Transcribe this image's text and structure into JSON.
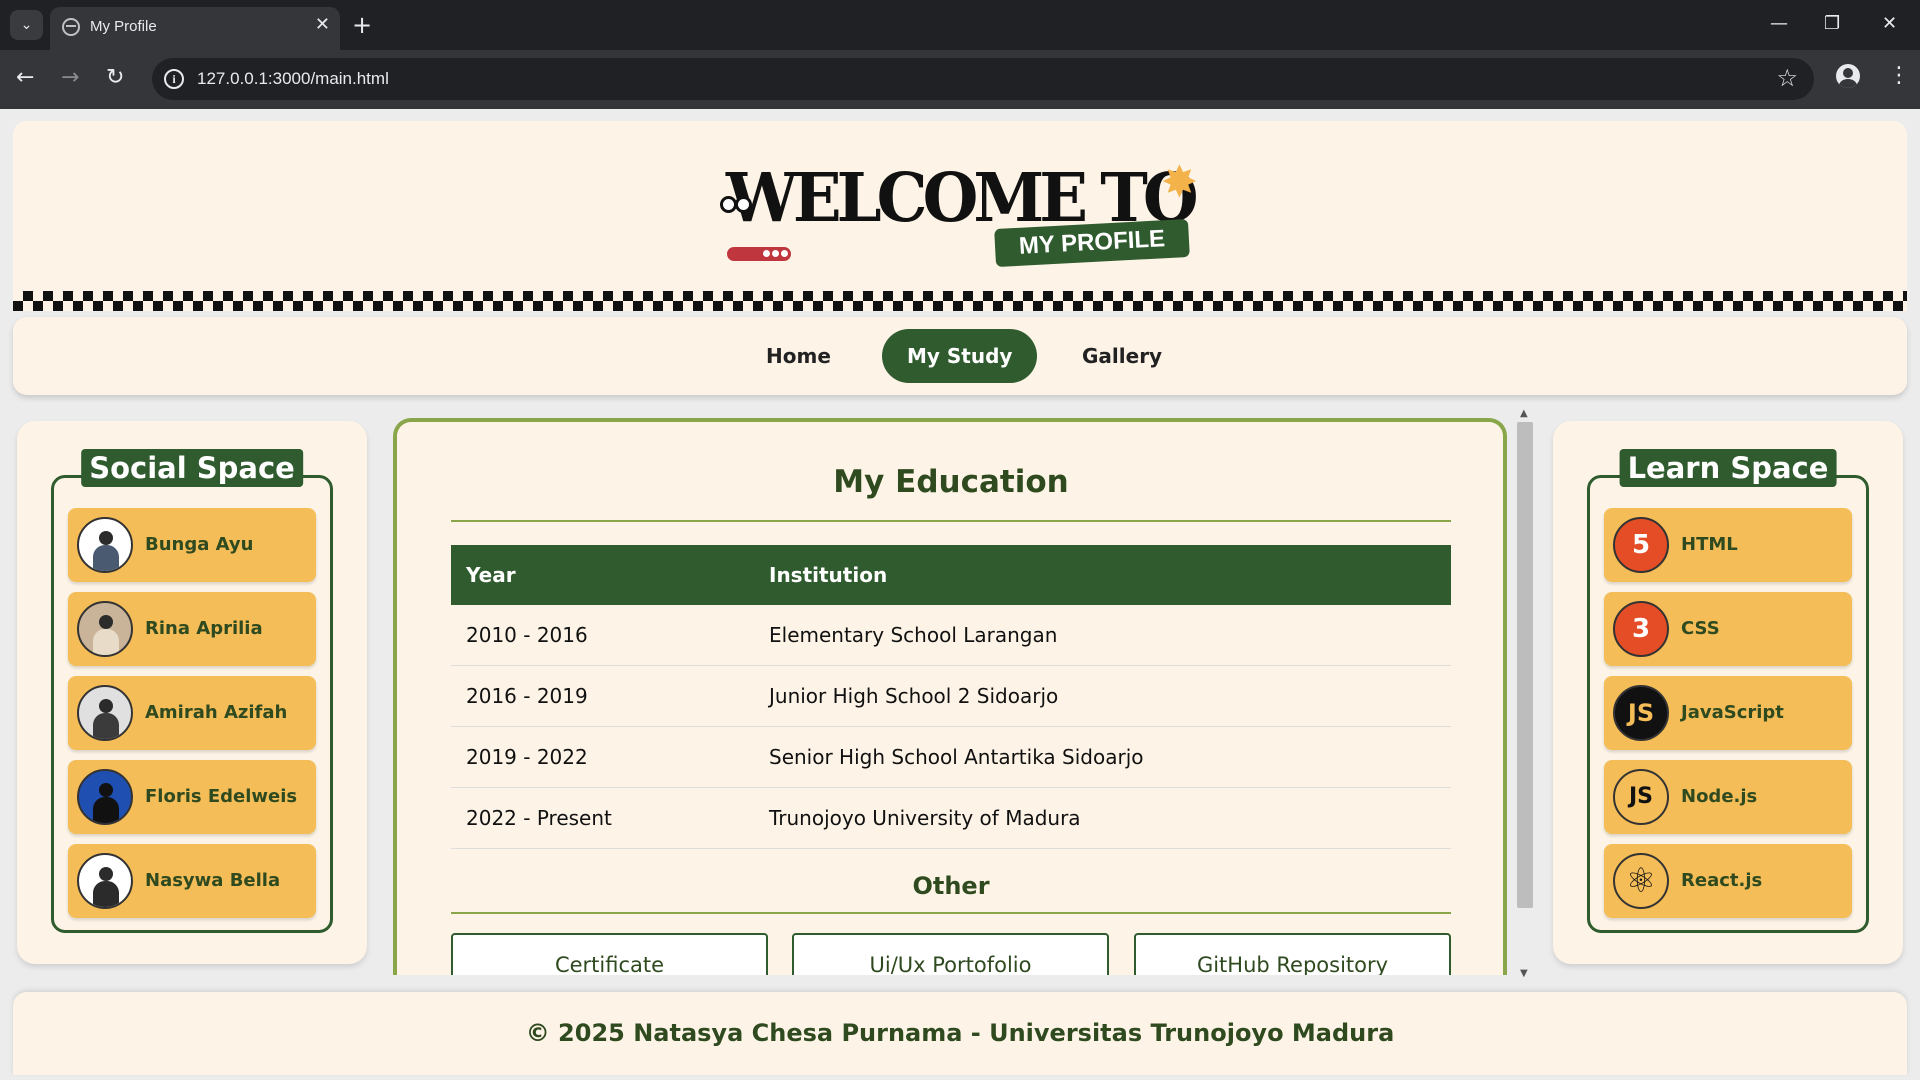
{
  "browser": {
    "tab_title": "My Profile",
    "url": "127.0.0.1:3000/main.html"
  },
  "banner": {
    "welcome_text": "WELCOME TO",
    "subtitle": "MY PROFILE"
  },
  "nav": {
    "items": [
      {
        "label": "Home",
        "active": false
      },
      {
        "label": "My Study",
        "active": true
      },
      {
        "label": "Gallery",
        "active": false
      }
    ]
  },
  "social": {
    "title": "Social Space",
    "items": [
      {
        "name": "Bunga Ayu"
      },
      {
        "name": "Rina Aprilia"
      },
      {
        "name": "Amirah Azifah"
      },
      {
        "name": "Floris Edelweis"
      },
      {
        "name": "Nasywa Bella"
      }
    ]
  },
  "learn": {
    "title": "Learn Space",
    "items": [
      {
        "name": "HTML",
        "icon": "html5-icon",
        "glyph": "5",
        "color": "#e44d26"
      },
      {
        "name": "CSS",
        "icon": "css3-icon",
        "glyph": "3",
        "color": "#e44d26"
      },
      {
        "name": "JavaScript",
        "icon": "javascript-icon",
        "glyph": "JS",
        "color": "#111111"
      },
      {
        "name": "Node.js",
        "icon": "nodejs-icon",
        "glyph": "JS",
        "color": "#111111"
      },
      {
        "name": "React.js",
        "icon": "react-icon",
        "glyph": "⚛",
        "color": "#111111"
      }
    ]
  },
  "education": {
    "title": "My Education",
    "headers": [
      "Year",
      "Institution"
    ],
    "rows": [
      {
        "year": "2010 - 2016",
        "institution": "Elementary School Larangan"
      },
      {
        "year": "2016 - 2019",
        "institution": "Junior High School 2 Sidoarjo"
      },
      {
        "year": "2019 - 2022",
        "institution": "Senior High School Antartika Sidoarjo"
      },
      {
        "year": "2022 - Present",
        "institution": "Trunojoyo University of Madura"
      }
    ],
    "other_title": "Other",
    "other_buttons": [
      "Certificate",
      "Ui/Ux Portofolio",
      "GitHub Repository"
    ]
  },
  "footer": {
    "text": "© 2025 Natasya Chesa Purnama - Universitas Trunojoyo Madura"
  },
  "colors": {
    "primary_green": "#2f5b2e",
    "accent_yellow": "#f4bd58",
    "cream": "#fdf4e7",
    "olive_border": "#8aa64a"
  }
}
